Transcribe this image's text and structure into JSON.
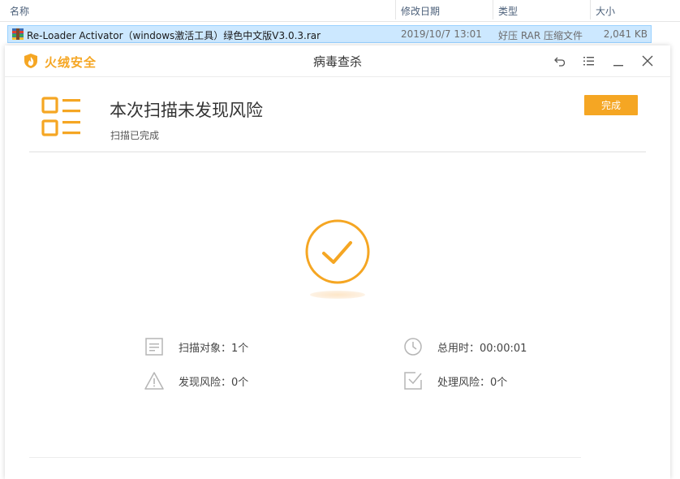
{
  "explorer": {
    "columns": {
      "name": "名称",
      "modified": "修改日期",
      "type": "类型",
      "size": "大小"
    },
    "file": {
      "name": "Re-Loader Activator（windows激活工具）绿色中文版V3.0.3.rar",
      "modified": "2019/10/7 13:01",
      "type": "好压 RAR 压缩文件",
      "size": "2,041 KB"
    }
  },
  "window": {
    "brand": "火绒安全",
    "title": "病毒查杀",
    "buttons": [
      "back-icon",
      "menu-icon",
      "minimize-icon",
      "close-icon"
    ]
  },
  "result": {
    "headline": "本次扫描未发现风险",
    "subline": "扫描已完成",
    "done_label": "完成"
  },
  "stats": {
    "scan_objects": "扫描对象：1个",
    "time_used": "总用时：00:00:01",
    "risks_found": "发现风险：0个",
    "risks_handled": "处理风险：0个"
  },
  "colors": {
    "accent": "#f5a623",
    "icon_gray": "#b5b5b5",
    "selection": "#cce8ff"
  }
}
